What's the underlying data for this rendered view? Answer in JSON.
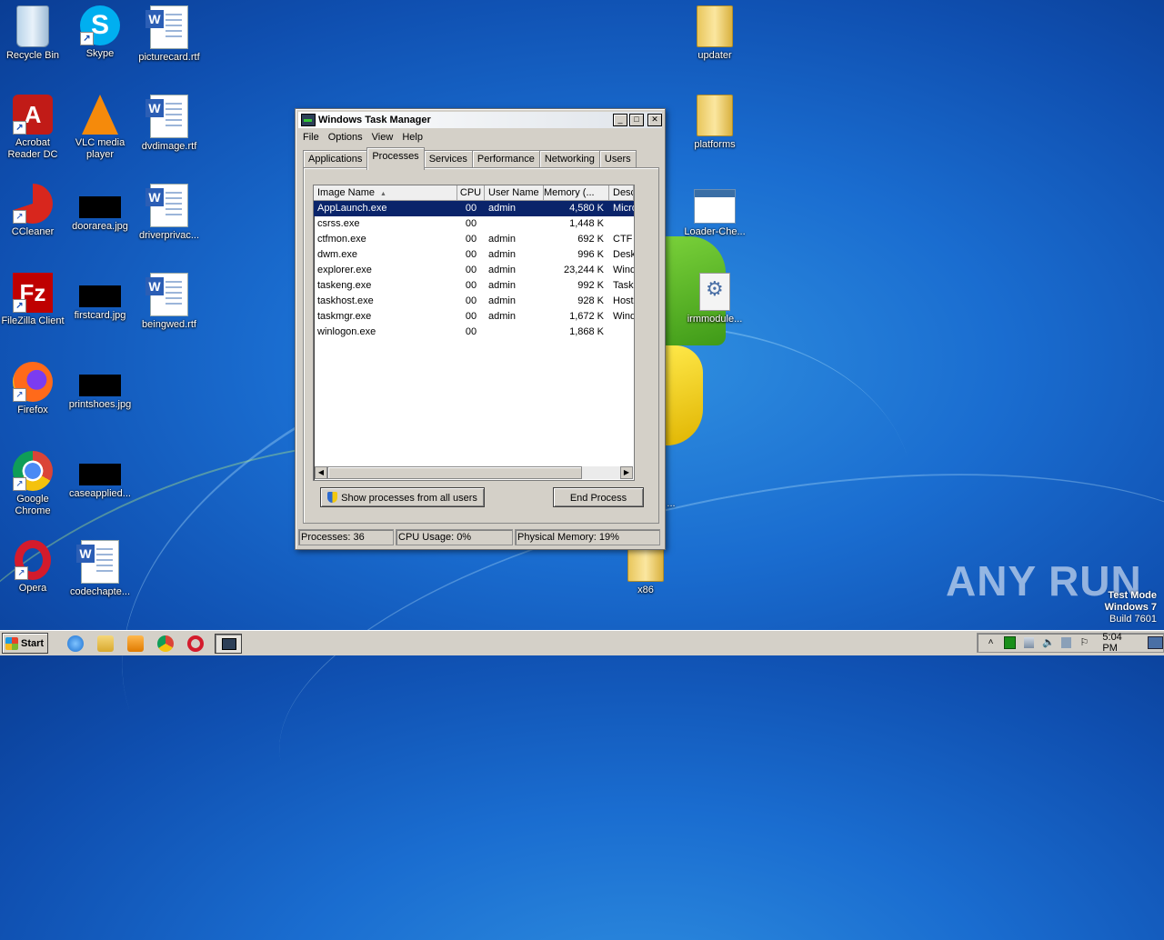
{
  "desktop": {
    "icons_left": [
      {
        "label": "Recycle Bin"
      },
      {
        "label": "Skype"
      },
      {
        "label": "picturecard.rtf"
      },
      {
        "label": "Acrobat Reader DC"
      },
      {
        "label": "VLC media player"
      },
      {
        "label": "dvdimage.rtf"
      },
      {
        "label": "CCleaner"
      },
      {
        "label": "doorarea.jpg"
      },
      {
        "label": "driverprivac..."
      },
      {
        "label": "FileZilla Client"
      },
      {
        "label": "firstcard.jpg"
      },
      {
        "label": "beingwed.rtf"
      },
      {
        "label": "Firefox"
      },
      {
        "label": "printshoes.jpg"
      },
      {
        "label": "Google Chrome"
      },
      {
        "label": "caseapplied..."
      },
      {
        "label": "Opera"
      },
      {
        "label": "codechapte..."
      }
    ],
    "icons_right": [
      {
        "label": "updater"
      },
      {
        "label": "platforms"
      },
      {
        "label": "Loader-Che..."
      },
      {
        "label": "irmmodule..."
      },
      {
        "label": "x86"
      }
    ],
    "partial_label": "..."
  },
  "taskmgr": {
    "title": "Windows Task Manager",
    "menu": [
      "File",
      "Options",
      "View",
      "Help"
    ],
    "tabs": [
      "Applications",
      "Processes",
      "Services",
      "Performance",
      "Networking",
      "Users"
    ],
    "active_tab": "Processes",
    "columns": [
      "Image Name",
      "CPU",
      "User Name",
      "Memory (...",
      "Desc"
    ],
    "rows": [
      {
        "name": "AppLaunch.exe",
        "cpu": "00",
        "user": "admin",
        "mem": "4,580 K",
        "desc": "Micro"
      },
      {
        "name": "csrss.exe",
        "cpu": "00",
        "user": "",
        "mem": "1,448 K",
        "desc": ""
      },
      {
        "name": "ctfmon.exe",
        "cpu": "00",
        "user": "admin",
        "mem": "692 K",
        "desc": "CTF I"
      },
      {
        "name": "dwm.exe",
        "cpu": "00",
        "user": "admin",
        "mem": "996 K",
        "desc": "Desk"
      },
      {
        "name": "explorer.exe",
        "cpu": "00",
        "user": "admin",
        "mem": "23,244 K",
        "desc": "Wind"
      },
      {
        "name": "taskeng.exe",
        "cpu": "00",
        "user": "admin",
        "mem": "992 K",
        "desc": "Task"
      },
      {
        "name": "taskhost.exe",
        "cpu": "00",
        "user": "admin",
        "mem": "928 K",
        "desc": "Host"
      },
      {
        "name": "taskmgr.exe",
        "cpu": "00",
        "user": "admin",
        "mem": "1,672 K",
        "desc": "Wind"
      },
      {
        "name": "winlogon.exe",
        "cpu": "00",
        "user": "",
        "mem": "1,868 K",
        "desc": ""
      }
    ],
    "show_all_label": "Show processes from all users",
    "end_process_label": "End Process",
    "status": {
      "processes": "Processes: 36",
      "cpu": "CPU Usage: 0%",
      "memory": "Physical Memory: 19%"
    }
  },
  "taskbar": {
    "start_label": "Start",
    "clock": "5:04 PM"
  },
  "watermark": {
    "line1": "Test Mode",
    "line2": "Windows 7",
    "line3": "Build 7601",
    "brand": "ANY RUN"
  }
}
